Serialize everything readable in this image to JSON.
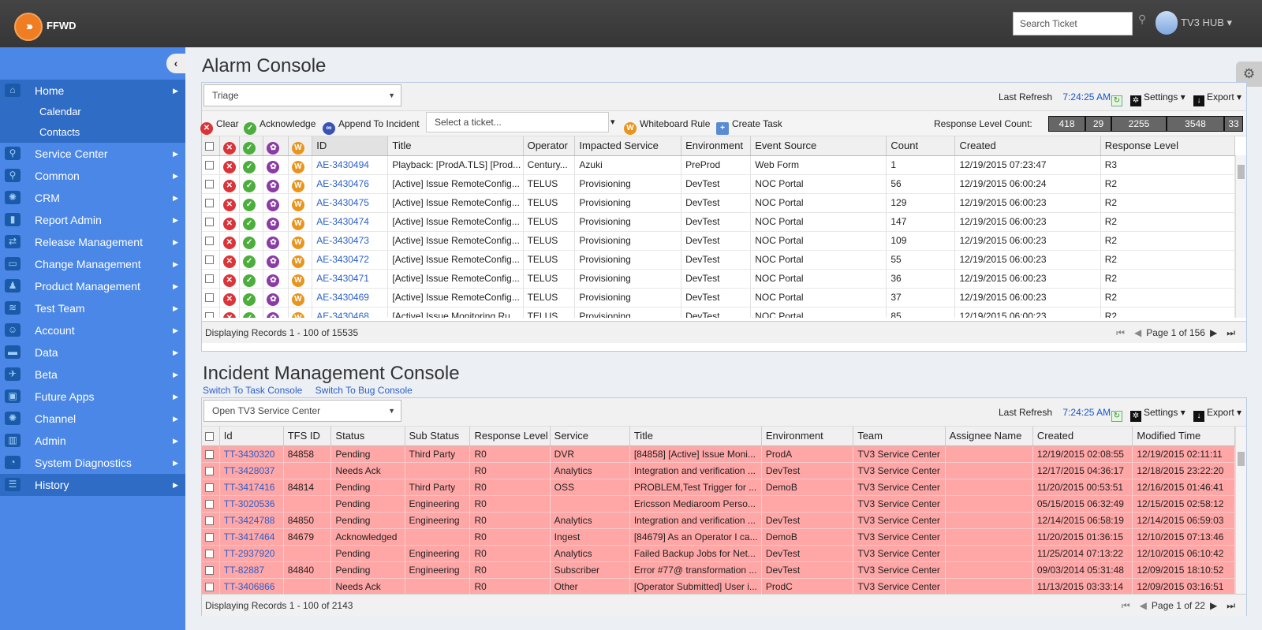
{
  "app": {
    "logo_text": "FFWD",
    "search_placeholder": "Search Ticket",
    "user": "TV3 HUB"
  },
  "sidebar": {
    "items": [
      {
        "label": "Home",
        "icon": "home-icon",
        "active": true,
        "sub": [
          "Calendar",
          "Contacts"
        ]
      },
      {
        "label": "Service Center",
        "icon": "service-icon"
      },
      {
        "label": "Common",
        "icon": "common-icon"
      },
      {
        "label": "CRM",
        "icon": "crm-icon"
      },
      {
        "label": "Report Admin",
        "icon": "chart-icon"
      },
      {
        "label": "Release Management",
        "icon": "release-icon"
      },
      {
        "label": "Change Management",
        "icon": "change-icon"
      },
      {
        "label": "Product Management",
        "icon": "product-icon"
      },
      {
        "label": "Test Team",
        "icon": "wifi-icon"
      },
      {
        "label": "Account",
        "icon": "users-icon"
      },
      {
        "label": "Data",
        "icon": "folder-icon"
      },
      {
        "label": "Beta",
        "icon": "beta-icon"
      },
      {
        "label": "Future Apps",
        "icon": "apps-icon"
      },
      {
        "label": "Channel",
        "icon": "channel-icon"
      },
      {
        "label": "Admin",
        "icon": "admin-icon"
      },
      {
        "label": "System Diagnostics",
        "icon": "gauge-icon"
      },
      {
        "label": "History",
        "icon": "history-icon",
        "active": true
      }
    ]
  },
  "alarm": {
    "title": "Alarm Console",
    "view": "Triage",
    "last_refresh_label": "Last Refresh",
    "last_refresh": "7:24:25 AM",
    "settings": "Settings",
    "export": "Export",
    "actions": {
      "clear": "Clear",
      "ack": "Acknowledge",
      "append": "Append To Incident",
      "ticket_placeholder": "Select a ticket...",
      "whiteboard": "Whiteboard Rule",
      "task": "Create Task"
    },
    "response_level_label": "Response Level Count:",
    "response_counts": [
      "418",
      "29",
      "2255",
      "3548",
      "33"
    ],
    "columns": [
      "ID",
      "Title",
      "Operator",
      "Impacted Service",
      "Environment",
      "Event Source",
      "Count",
      "Created",
      "Response Level"
    ],
    "rows": [
      [
        "AE-3430494",
        "Playback: [ProdA.TLS] [Prod...",
        "Century...",
        "Azuki",
        "PreProd",
        "Web Form",
        "1",
        "12/19/2015 07:23:47",
        "R3"
      ],
      [
        "AE-3430476",
        "[Active] Issue RemoteConfig...",
        "TELUS",
        "Provisioning",
        "DevTest",
        "NOC Portal",
        "56",
        "12/19/2015 06:00:24",
        "R2"
      ],
      [
        "AE-3430475",
        "[Active] Issue RemoteConfig...",
        "TELUS",
        "Provisioning",
        "DevTest",
        "NOC Portal",
        "129",
        "12/19/2015 06:00:23",
        "R2"
      ],
      [
        "AE-3430474",
        "[Active] Issue RemoteConfig...",
        "TELUS",
        "Provisioning",
        "DevTest",
        "NOC Portal",
        "147",
        "12/19/2015 06:00:23",
        "R2"
      ],
      [
        "AE-3430473",
        "[Active] Issue RemoteConfig...",
        "TELUS",
        "Provisioning",
        "DevTest",
        "NOC Portal",
        "109",
        "12/19/2015 06:00:23",
        "R2"
      ],
      [
        "AE-3430472",
        "[Active] Issue RemoteConfig...",
        "TELUS",
        "Provisioning",
        "DevTest",
        "NOC Portal",
        "55",
        "12/19/2015 06:00:23",
        "R2"
      ],
      [
        "AE-3430471",
        "[Active] Issue RemoteConfig...",
        "TELUS",
        "Provisioning",
        "DevTest",
        "NOC Portal",
        "36",
        "12/19/2015 06:00:23",
        "R2"
      ],
      [
        "AE-3430469",
        "[Active] Issue RemoteConfig...",
        "TELUS",
        "Provisioning",
        "DevTest",
        "NOC Portal",
        "37",
        "12/19/2015 06:00:23",
        "R2"
      ],
      [
        "AE-3430468",
        "[Active] Issue Monitoring.Ru...",
        "TELUS",
        "Provisioning",
        "DevTest",
        "NOC Portal",
        "85",
        "12/19/2015 06:00:23",
        "R2"
      ]
    ],
    "records": "Displaying Records 1 - 100 of 15535",
    "page": "Page 1 of 156"
  },
  "incident": {
    "title": "Incident Management Console",
    "switch_task": "Switch To Task Console",
    "switch_bug": "Switch To Bug Console",
    "view": "Open TV3 Service Center",
    "last_refresh_label": "Last Refresh",
    "last_refresh": "7:24:25 AM",
    "settings": "Settings",
    "export": "Export",
    "columns": [
      "Id",
      "TFS ID",
      "Status",
      "Sub Status",
      "Response Level",
      "Service",
      "Title",
      "Environment",
      "Team",
      "Assignee Name",
      "Created",
      "Modified Time"
    ],
    "rows": [
      [
        "TT-3430320",
        "84858",
        "Pending",
        "Third Party",
        "R0",
        "DVR",
        "[84858] [Active] Issue Moni...",
        "ProdA",
        "TV3 Service Center",
        "",
        "12/19/2015 02:08:55",
        "12/19/2015 02:11:11"
      ],
      [
        "TT-3428037",
        "",
        "Needs Ack",
        "",
        "R0",
        "Analytics",
        "Integration and verification ...",
        "DevTest",
        "TV3 Service Center",
        "",
        "12/17/2015 04:36:17",
        "12/18/2015 23:22:20"
      ],
      [
        "TT-3417416",
        "84814",
        "Pending",
        "Third Party",
        "R0",
        "OSS",
        "PROBLEM,Test Trigger for ...",
        "DemoB",
        "TV3 Service Center",
        "",
        "11/20/2015 00:53:51",
        "12/16/2015 01:46:41"
      ],
      [
        "TT-3020536",
        "",
        "Pending",
        "Engineering",
        "R0",
        "",
        "Ericsson Mediaroom Perso...",
        "",
        "TV3 Service Center",
        "",
        "05/15/2015 06:32:49",
        "12/15/2015 02:58:12"
      ],
      [
        "TT-3424788",
        "84850",
        "Pending",
        "Engineering",
        "R0",
        "Analytics",
        "Integration and verification ...",
        "DevTest",
        "TV3 Service Center",
        "",
        "12/14/2015 06:58:19",
        "12/14/2015 06:59:03"
      ],
      [
        "TT-3417464",
        "84679",
        "Acknowledged",
        "",
        "R0",
        "Ingest",
        "[84679] As an Operator I ca...",
        "DemoB",
        "TV3 Service Center",
        "",
        "11/20/2015 01:36:15",
        "12/10/2015 07:13:46"
      ],
      [
        "TT-2937920",
        "",
        "Pending",
        "Engineering",
        "R0",
        "Analytics",
        "Failed Backup Jobs for Net...",
        "DevTest",
        "TV3 Service Center",
        "",
        "11/25/2014 07:13:22",
        "12/10/2015 06:10:42"
      ],
      [
        "TT-82887",
        "84840",
        "Pending",
        "Engineering",
        "R0",
        "Subscriber",
        "Error #77@ transformation ...",
        "DevTest",
        "TV3 Service Center",
        "",
        "09/03/2014 05:31:48",
        "12/09/2015 18:10:52"
      ],
      [
        "TT-3406866",
        "",
        "Needs Ack",
        "",
        "R0",
        "Other",
        "[Operator Submitted] User i...",
        "ProdC",
        "TV3 Service Center",
        "",
        "11/13/2015 03:33:14",
        "12/09/2015 03:16:51"
      ]
    ],
    "records": "Displaying Records 1 - 100 of 2143",
    "page": "Page 1 of 22"
  }
}
